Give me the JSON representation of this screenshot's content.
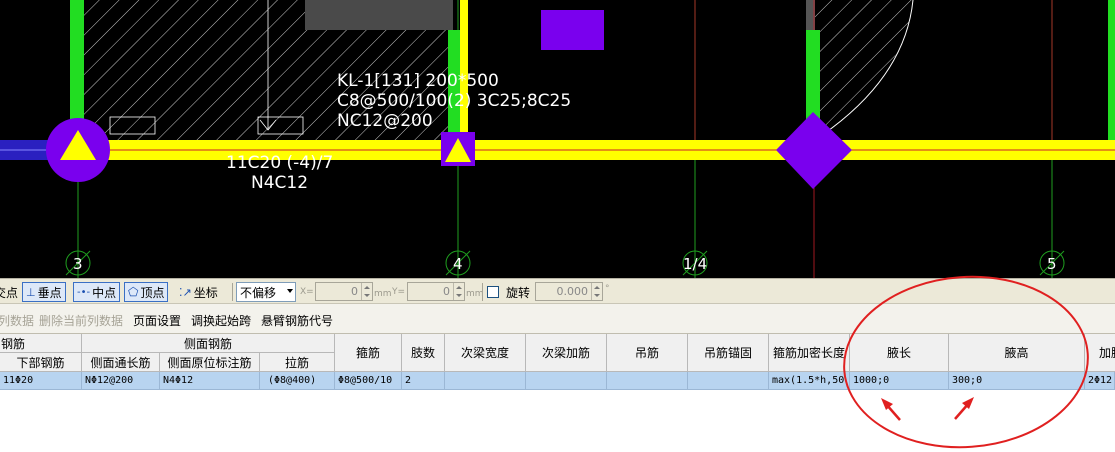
{
  "canvas": {
    "beam_label_lines": [
      "KL-1[131] 200*500",
      "C8@500/100(2) 3C25;8C25",
      "NC12@200"
    ],
    "bottom_label_lines": [
      "11C20 (-4)/7",
      "N4C12"
    ],
    "axis_labels": [
      "3",
      "4",
      "1/4",
      "5"
    ]
  },
  "snapbar": {
    "items": [
      "交点",
      "垂点",
      "中点",
      "顶点",
      "坐标"
    ],
    "offset_select": "不偏移",
    "x_label": "X=",
    "x_value": "0",
    "x_unit": "mm",
    "y_label": "Y=",
    "y_value": "0",
    "y_unit": "mm",
    "rotate_label": "旋转",
    "rotate_value": "0.000",
    "degree": "°"
  },
  "toolbar2": {
    "items": [
      "列数据",
      "删除当前列数据",
      "页面设置",
      "调换起始跨",
      "悬臂钢筋代号"
    ]
  },
  "grid": {
    "group_headers": [
      "钢筋",
      "侧面钢筋"
    ],
    "sub_headers": [
      "下部钢筋",
      "侧面通长筋",
      "侧面原位标注筋",
      "拉筋"
    ],
    "columns": [
      "箍筋",
      "肢数",
      "次梁宽度",
      "次梁加筋",
      "吊筋",
      "吊筋锚固",
      "箍筋加密长度",
      "腋长",
      "腋高",
      "加腋"
    ],
    "row": [
      "11Φ20",
      "NΦ12@200",
      "N4Φ12",
      "(Φ8@400)",
      "Φ8@500/10",
      "2",
      "",
      "",
      "",
      "",
      "max(1.5*h,50",
      "1000;0",
      "300;0",
      "2Φ12"
    ]
  },
  "annotation_colors": {
    "ellipse": "#e02020",
    "arrows": "#e02020"
  }
}
